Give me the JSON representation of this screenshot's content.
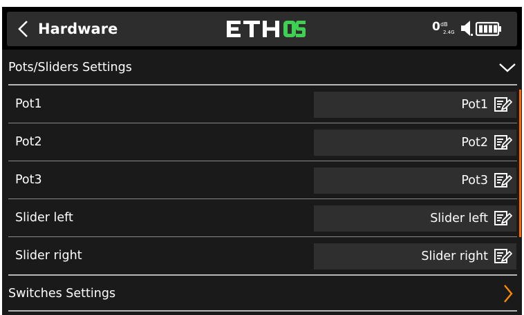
{
  "header": {
    "back_label": "Hardware",
    "brand": "ETHOS",
    "rf_level": "0",
    "rf_unit": "dB",
    "rf_band": "2.4G",
    "icons": [
      "chevron-left-icon",
      "signal-icon",
      "battery-icon"
    ]
  },
  "pots_section": {
    "title": "Pots/Sliders Settings",
    "state": "expanded",
    "rows": [
      {
        "label": "Pot1",
        "value": "Pot1"
      },
      {
        "label": "Pot2",
        "value": "Pot2"
      },
      {
        "label": "Pot3",
        "value": "Pot3"
      },
      {
        "label": "Slider left",
        "value": "Slider left"
      },
      {
        "label": "Slider right",
        "value": "Slider right"
      }
    ]
  },
  "switches_section": {
    "title": "Switches Settings",
    "state": "collapsed"
  },
  "colors": {
    "background": "#1a1a1a",
    "header": "#2d2d2d",
    "field": "#2f2f2f",
    "accent_orange": "#ff6a00",
    "brand_green": "#3fcf52"
  }
}
